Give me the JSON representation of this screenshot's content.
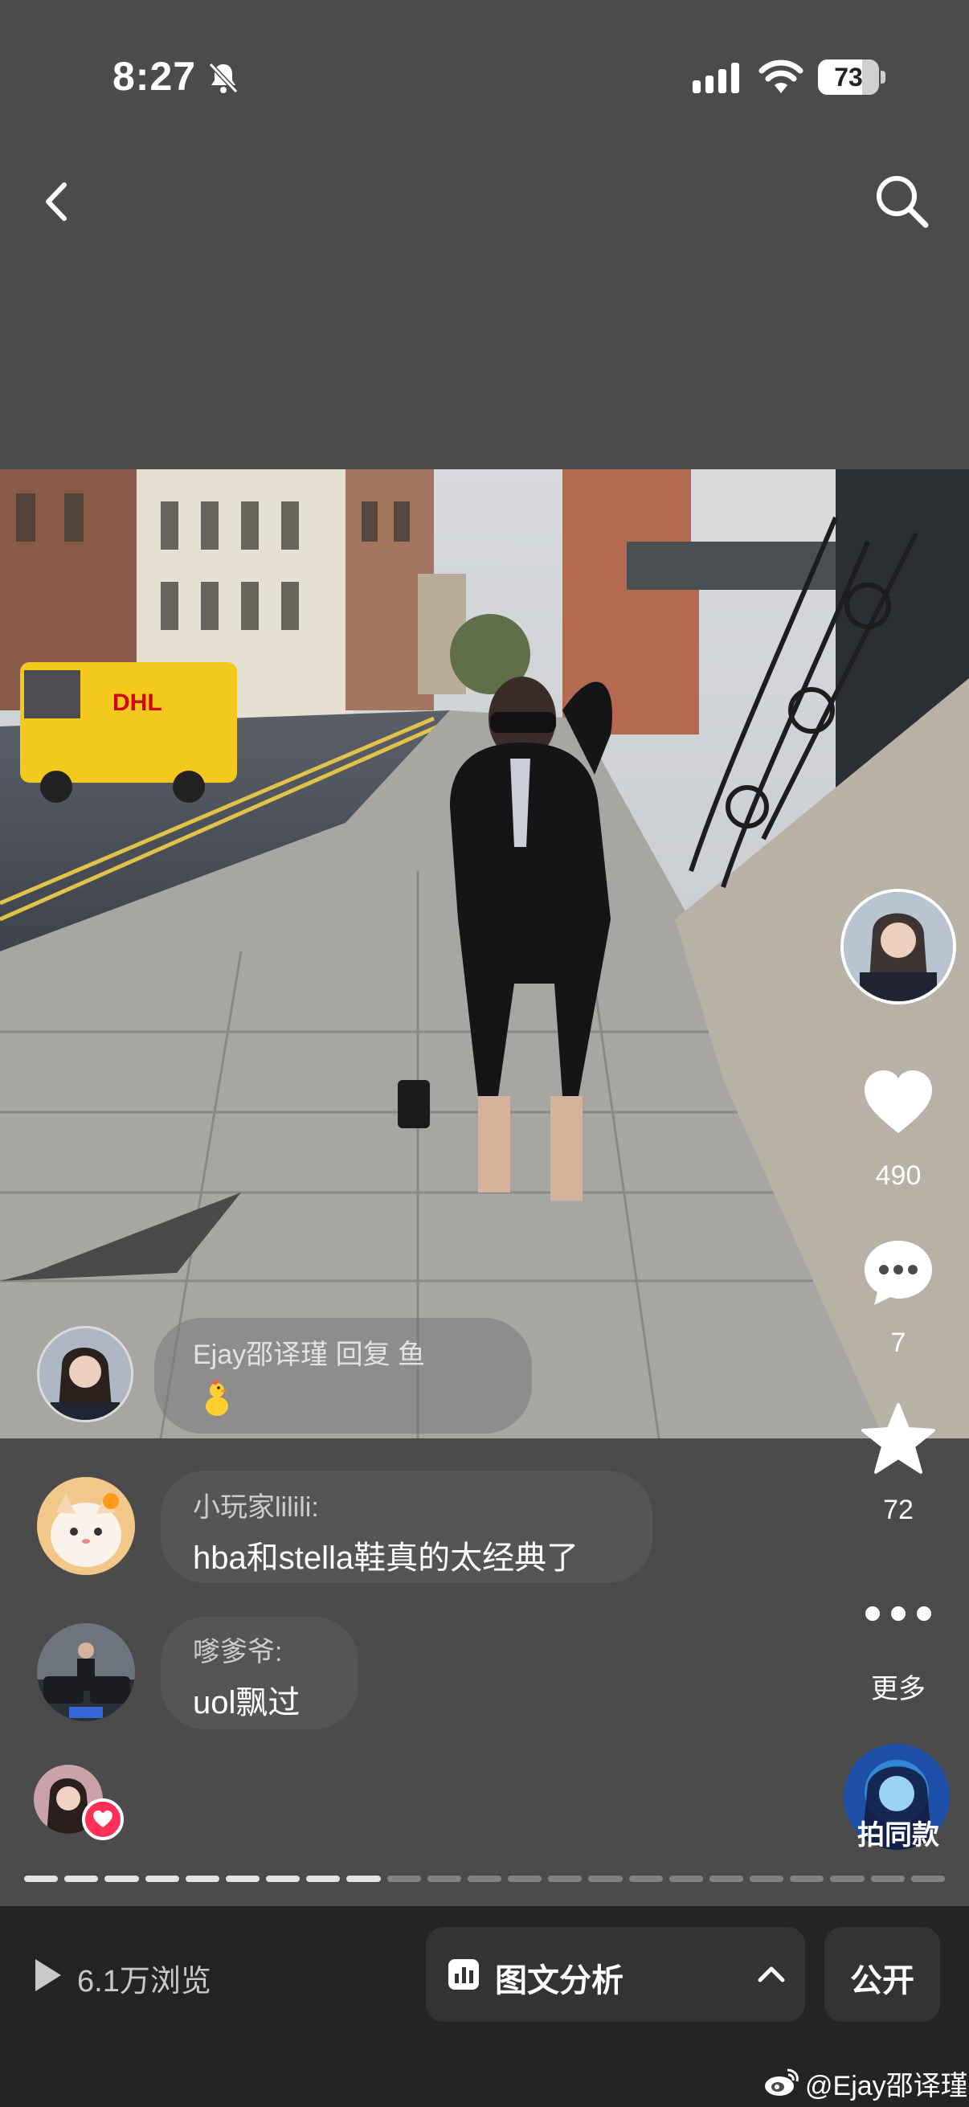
{
  "status_bar": {
    "time": "8:27",
    "battery_level": 73,
    "battery_text": "73"
  },
  "nav": {
    "back_icon": "chevron-left-icon",
    "search_icon": "search-icon"
  },
  "post": {
    "likes": "490",
    "comments": "7",
    "favorites": "72",
    "more_label": "更多",
    "remix_label": "拍同款"
  },
  "floating_comment": {
    "text": "Ejay邵译瑾 回复 鱼",
    "emoji": "chick-emoji"
  },
  "comments": [
    {
      "name": "小玩家lilili:",
      "text": "hba和stella鞋真的太经典了"
    },
    {
      "name": "嗲爹爷:",
      "text": "uol飘过"
    }
  ],
  "carousel": {
    "total_pages": 23,
    "current_page": 9
  },
  "bottom_bar": {
    "views": "6.1万浏览",
    "analysis_label": "图文分析",
    "public_label": "公开"
  },
  "watermark": "@Ejay邵译瑾",
  "colors": {
    "background": "#4b4b4b",
    "bottom_bar": "#242424",
    "heart_badge": "#ff2f55"
  }
}
